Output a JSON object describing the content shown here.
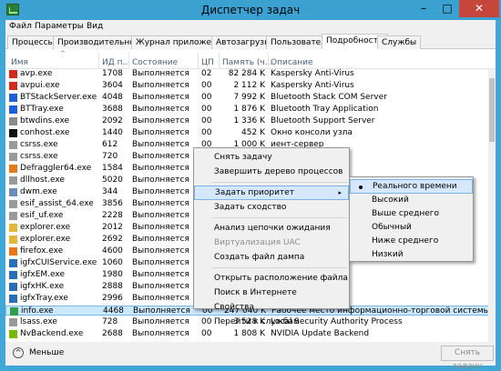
{
  "title": "Диспетчер задач",
  "window_buttons": {
    "minimize": "–",
    "maximize": "□",
    "close": "✕"
  },
  "menu": [
    "Файл",
    "Параметры",
    "Вид"
  ],
  "tabs": [
    "Процессы",
    "Производительность",
    "Журнал приложений",
    "Автозагрузка",
    "Пользователи",
    "Подробности",
    "Службы"
  ],
  "active_tab": "Подробности",
  "columns": {
    "name": "Имя",
    "pid": "ИД п...",
    "status": "Состояние",
    "cpu": "ЦП",
    "mem": "Память (ч...",
    "desc": "Описание",
    "sort_indicator": "^"
  },
  "rows": [
    {
      "icon": "kaspersky-icon",
      "color": "#d12b1f",
      "name": "avp.exe",
      "pid": "1708",
      "status": "Выполняется",
      "cpu": "02",
      "mem": "82 284 K",
      "desc": "Kaspersky Anti-Virus"
    },
    {
      "icon": "kaspersky-icon",
      "color": "#d12b1f",
      "name": "avpui.exe",
      "pid": "3604",
      "status": "Выполняется",
      "cpu": "00",
      "mem": "2 112 K",
      "desc": "Kaspersky Anti-Virus"
    },
    {
      "icon": "bluetooth-icon",
      "color": "#1f5fd6",
      "name": "BTStackServer.exe",
      "pid": "4048",
      "status": "Выполняется",
      "cpu": "00",
      "mem": "7 992 K",
      "desc": "Bluetooth Stack COM Server"
    },
    {
      "icon": "bluetooth-icon",
      "color": "#1f5fd6",
      "name": "BTTray.exe",
      "pid": "3688",
      "status": "Выполняется",
      "cpu": "00",
      "mem": "1 876 K",
      "desc": "Bluetooth Tray Application"
    },
    {
      "icon": "app-icon",
      "color": "#8a8a8a",
      "name": "btwdins.exe",
      "pid": "2092",
      "status": "Выполняется",
      "cpu": "00",
      "mem": "1 336 K",
      "desc": "Bluetooth Support Server"
    },
    {
      "icon": "console-icon",
      "color": "#111111",
      "name": "conhost.exe",
      "pid": "1440",
      "status": "Выполняется",
      "cpu": "00",
      "mem": "452 K",
      "desc": "Окно консоли узла"
    },
    {
      "icon": "app-icon",
      "color": "#9a9a9a",
      "name": "csrss.exe",
      "pid": "612",
      "status": "Выполняется",
      "cpu": "00",
      "mem": "1 000 K",
      "desc": "иент-сервер"
    },
    {
      "icon": "app-icon",
      "color": "#9a9a9a",
      "name": "csrss.exe",
      "pid": "720",
      "status": "Выполняется",
      "cpu": "00",
      "mem": "",
      "desc": "иент-сервер"
    },
    {
      "icon": "defraggler-icon",
      "color": "#e07a1f",
      "name": "Defraggler64.exe",
      "pid": "1584",
      "status": "Выполняется",
      "cpu": "",
      "mem": "",
      "desc": ""
    },
    {
      "icon": "app-icon",
      "color": "#9a9a9a",
      "name": "dllhost.exe",
      "pid": "5020",
      "status": "Выполняется",
      "cpu": "",
      "mem": "",
      "desc": ""
    },
    {
      "icon": "app-icon",
      "color": "#6b8fb8",
      "name": "dwm.exe",
      "pid": "344",
      "status": "Выполняется",
      "cpu": "",
      "mem": "",
      "desc": ""
    },
    {
      "icon": "app-icon",
      "color": "#9a9a9a",
      "name": "esif_assist_64.exe",
      "pid": "3856",
      "status": "Выполняется",
      "cpu": "",
      "mem": "",
      "desc": ""
    },
    {
      "icon": "app-icon",
      "color": "#9a9a9a",
      "name": "esif_uf.exe",
      "pid": "2228",
      "status": "Выполняется",
      "cpu": "",
      "mem": "",
      "desc": ""
    },
    {
      "icon": "explorer-icon",
      "color": "#e3b53b",
      "name": "explorer.exe",
      "pid": "2012",
      "status": "Выполняется",
      "cpu": "",
      "mem": "",
      "desc": ""
    },
    {
      "icon": "explorer-icon",
      "color": "#e3b53b",
      "name": "explorer.exe",
      "pid": "2692",
      "status": "Выполняется",
      "cpu": "",
      "mem": "",
      "desc": ""
    },
    {
      "icon": "firefox-icon",
      "color": "#e8761b",
      "name": "firefox.exe",
      "pid": "4600",
      "status": "Выполняется",
      "cpu": "",
      "mem": "",
      "desc": ""
    },
    {
      "icon": "intel-icon",
      "color": "#2a6fb5",
      "name": "igfxCUIService.exe",
      "pid": "1060",
      "status": "Выполняется",
      "cpu": "",
      "mem": "",
      "desc": ""
    },
    {
      "icon": "intel-icon",
      "color": "#2a6fb5",
      "name": "igfxEM.exe",
      "pid": "1980",
      "status": "Выполняется",
      "cpu": "",
      "mem": "",
      "desc": ""
    },
    {
      "icon": "intel-icon",
      "color": "#2a6fb5",
      "name": "igfxHK.exe",
      "pid": "2888",
      "status": "Выполняется",
      "cpu": "",
      "mem": "",
      "desc": ""
    },
    {
      "icon": "intel-icon",
      "color": "#2a6fb5",
      "name": "igfxTray.exe",
      "pid": "2996",
      "status": "Выполняется",
      "cpu": "",
      "mem": "",
      "desc": ""
    },
    {
      "icon": "quik-icon",
      "color": "#2e9e4e",
      "name": "info.exe",
      "pid": "4468",
      "status": "Выполняется",
      "cpu": "00",
      "mem": "247 040 K",
      "desc": "Рабочее место информационно-торговой системы QUIK",
      "selected": true
    },
    {
      "icon": "app-icon",
      "color": "#9a9a9a",
      "name": "lsass.exe",
      "pid": "728",
      "status": "Выполняется",
      "cpu": "00",
      "mem": "3 528 K",
      "desc": "Local Security Authority Process"
    },
    {
      "icon": "nvidia-icon",
      "color": "#76b900",
      "name": "NvBackend.exe",
      "pid": "2688",
      "status": "Выполняется",
      "cpu": "00",
      "mem": "1 808 K",
      "desc": "NVIDIA Update Backend"
    }
  ],
  "context_menu": {
    "items": [
      {
        "label": "Снять задачу"
      },
      {
        "label": "Завершить дерево процессов"
      },
      {
        "sep": true
      },
      {
        "label": "Задать приоритет",
        "submenu": true,
        "highlighted": true
      },
      {
        "label": "Задать сходство"
      },
      {
        "sep": true
      },
      {
        "label": "Анализ цепочки ожидания"
      },
      {
        "label": "Виртуализация UAC",
        "disabled": true
      },
      {
        "label": "Создать файл дампа"
      },
      {
        "sep": true
      },
      {
        "label": "Открыть расположение файла"
      },
      {
        "label": "Поиск в Интернете"
      },
      {
        "label": "Свойства"
      },
      {
        "label": "Перейти к службам"
      }
    ],
    "submenu_arrow": "▸"
  },
  "priority_submenu": {
    "items": [
      {
        "label": "Реального времени",
        "checked": true,
        "highlighted": true
      },
      {
        "label": "Высокий"
      },
      {
        "label": "Выше среднего"
      },
      {
        "label": "Обычный"
      },
      {
        "label": "Ниже среднего"
      },
      {
        "label": "Низкий"
      }
    ]
  },
  "footer": {
    "less_label": "Меньше",
    "less_icon": "^",
    "end_task": "Снять задачу"
  }
}
